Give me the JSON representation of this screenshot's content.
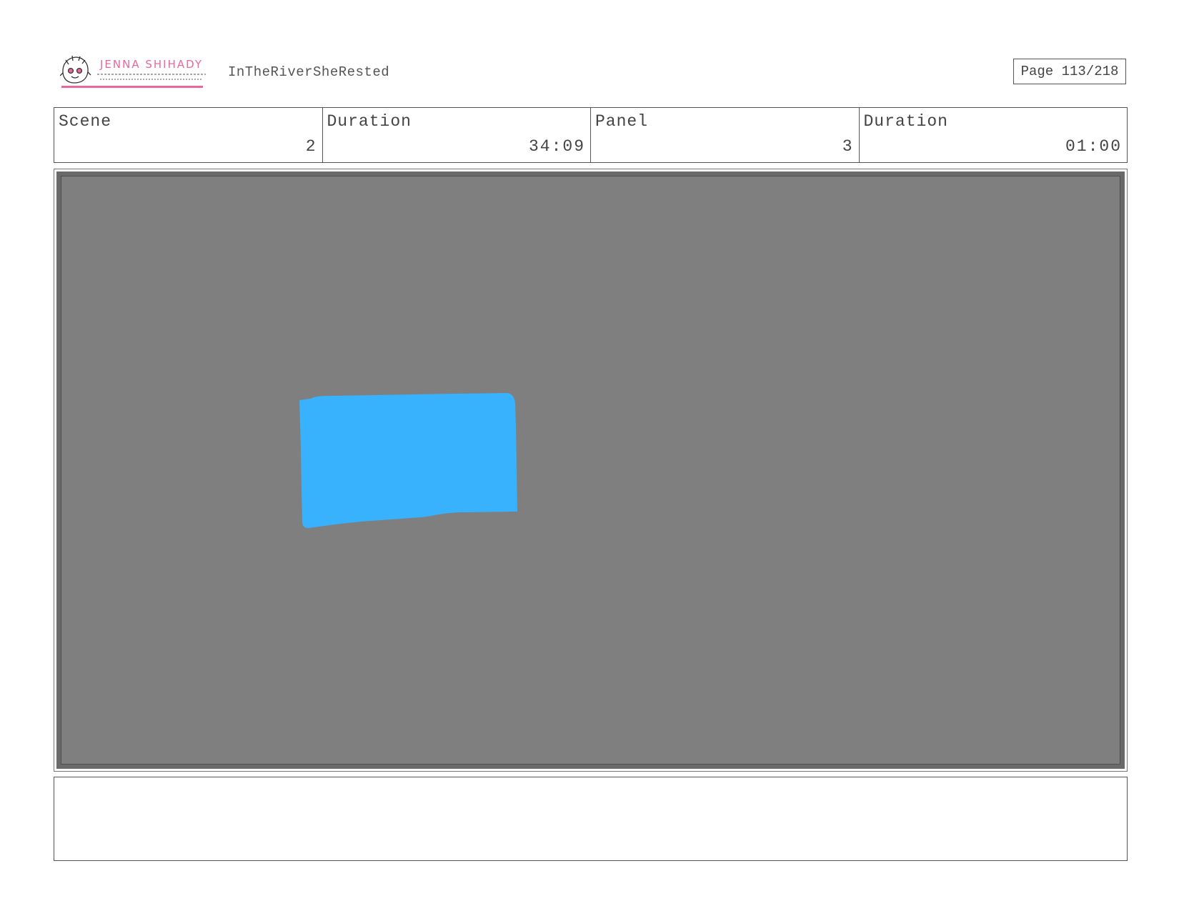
{
  "header": {
    "logo_name": "JENNA SHIHADY",
    "project_title": "InTheRiverSheRested",
    "page_label": "Page 113/218"
  },
  "info": {
    "scene_label": "Scene",
    "scene_value": "2",
    "scene_duration_label": "Duration",
    "scene_duration_value": "34:09",
    "panel_label": "Panel",
    "panel_value": "3",
    "panel_duration_label": "Duration",
    "panel_duration_value": "01:00"
  },
  "panel": {
    "background_color": "#7f7f7f",
    "shape_color": "#38b2fc"
  },
  "notes": {
    "text": ""
  },
  "colors": {
    "logo_pink": "#e8689e"
  }
}
